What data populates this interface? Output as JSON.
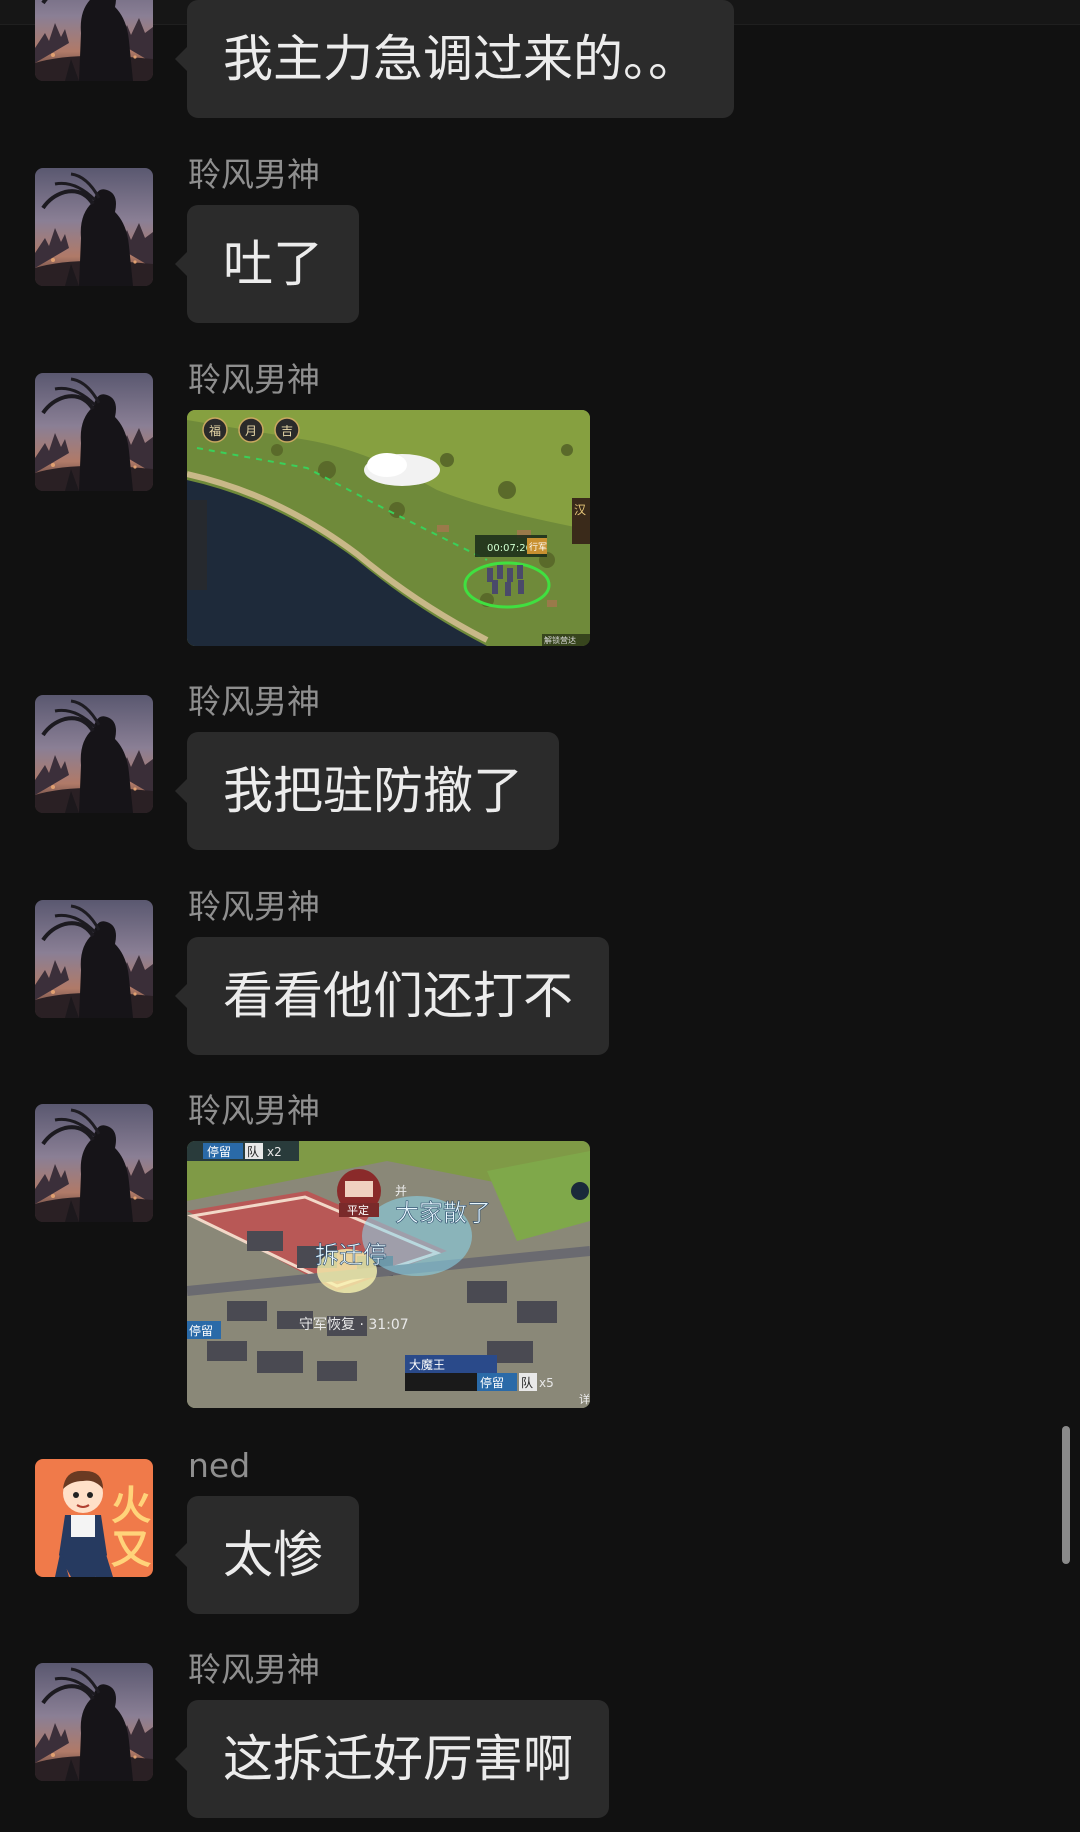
{
  "app": {
    "title": "",
    "accent_bubble_color": "#2b2b2b",
    "background_color": "#111111"
  },
  "messages": [
    {
      "sender": "",
      "type": "text",
      "text": "我主力急调过来的。。",
      "avatar": "warrior-avatar"
    },
    {
      "sender": "聆风男神",
      "type": "text",
      "text": "吐了",
      "avatar": "warrior-avatar"
    },
    {
      "sender": "聆风男神",
      "type": "image",
      "image": "game-map-screenshot",
      "overlay": {
        "buttons": [
          "福",
          "月",
          "吉"
        ],
        "timer": "00:07:26",
        "tag": "行军",
        "corner": "解锁营达",
        "side": "汉"
      }
    },
    {
      "sender": "聆风男神",
      "type": "text",
      "text": "我把驻防撤了",
      "avatar": "warrior-avatar"
    },
    {
      "sender": "聆风男神",
      "type": "text",
      "text": "看看他们还打不",
      "avatar": "warrior-avatar"
    },
    {
      "sender": "聆风男神",
      "type": "image",
      "image": "game-city-screenshot",
      "overlay": {
        "top_tag": "停留",
        "top_count": "队",
        "top_mult": "x2",
        "badge": "平定",
        "flag": "并",
        "chat1": "大家散了",
        "chat2": "拆迁停",
        "recover": "守军恢复 · 31:07",
        "left_tag": "停留",
        "player": "大魔王",
        "bottom_tag": "停留",
        "bottom_count": "队",
        "bottom_mult": "x5",
        "corner": "详"
      }
    },
    {
      "sender": "ned",
      "type": "text",
      "text": "太惨",
      "avatar": "cartoon-avatar"
    },
    {
      "sender": "聆风男神",
      "type": "text",
      "text": "这拆迁好厉害啊",
      "avatar": "warrior-avatar"
    }
  ]
}
